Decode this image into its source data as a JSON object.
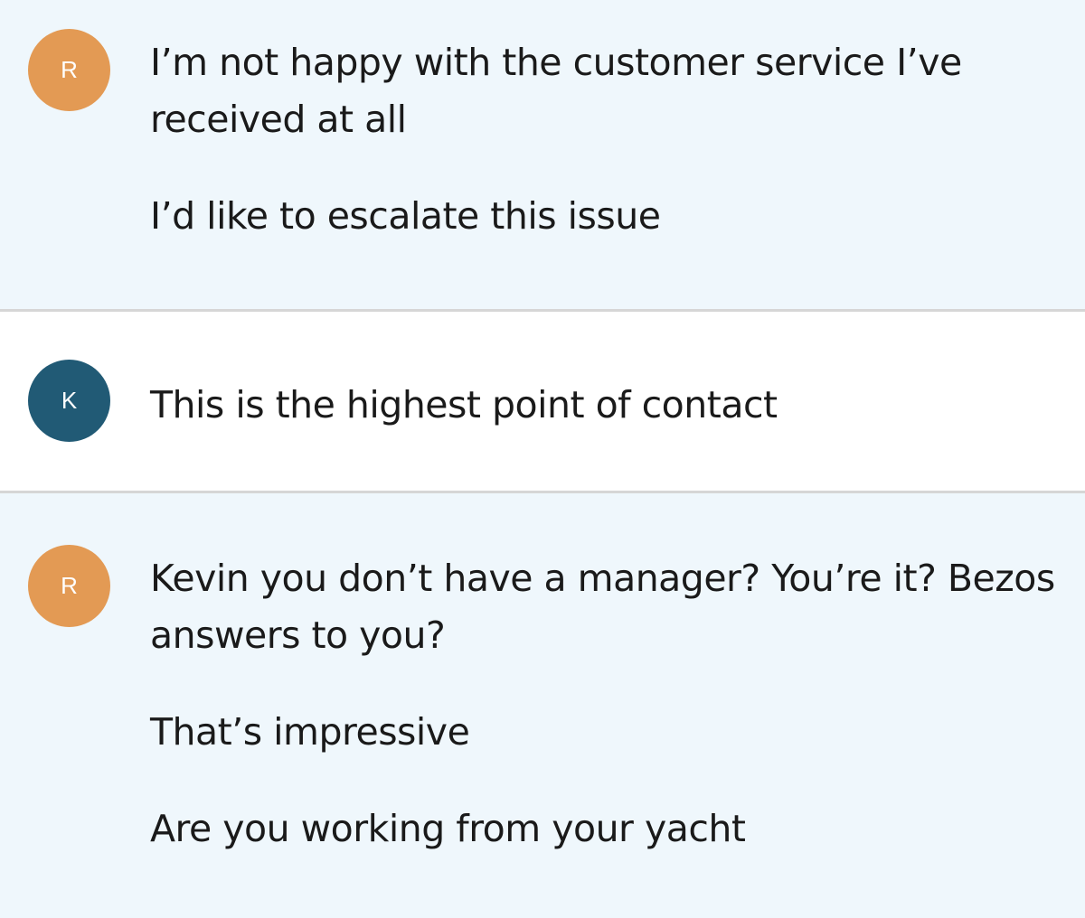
{
  "colors": {
    "customer_background": "#eff7fc",
    "agent_background": "#ffffff",
    "customer_avatar": "#e39a54",
    "agent_avatar": "#215a75",
    "divider": "#d6d6d6",
    "text": "#1a1a1a"
  },
  "conversation": [
    {
      "role": "customer",
      "avatar_initial": "R",
      "messages": [
        "I’m not happy with the customer service I’ve received at all",
        "I’d like to escalate this issue"
      ]
    },
    {
      "role": "agent",
      "avatar_initial": "K",
      "messages": [
        "This is the highest point of contact"
      ]
    },
    {
      "role": "customer",
      "avatar_initial": "R",
      "messages": [
        "Kevin you don’t have a manager? You’re it? Bezos answers to you?",
        "That’s impressive",
        "Are you working from your yacht"
      ]
    }
  ]
}
